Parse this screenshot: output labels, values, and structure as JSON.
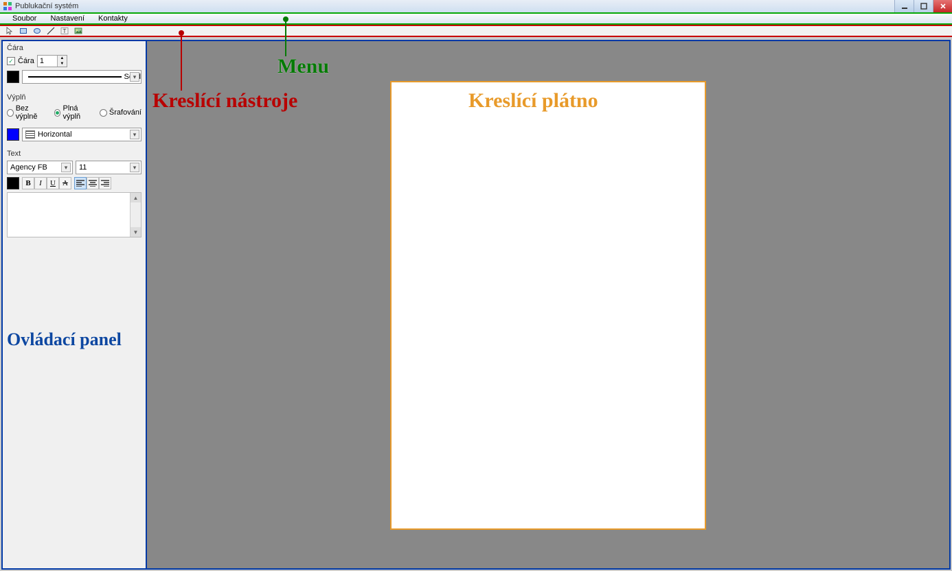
{
  "window": {
    "title": "Publukační systém"
  },
  "menu": {
    "items": [
      "Soubor",
      "Nastavení",
      "Kontakty"
    ]
  },
  "toolbar": {
    "tools": [
      "pointer",
      "rectangle",
      "ellipse",
      "line",
      "text",
      "image"
    ]
  },
  "panel": {
    "line": {
      "group_label": "Čára",
      "checkbox_label": "Čára",
      "checkbox_checked": true,
      "width_value": "1",
      "style_label": "Solid",
      "color": "#000000"
    },
    "fill": {
      "group_label": "Výplň",
      "options": [
        {
          "label": "Bez výplně",
          "selected": false
        },
        {
          "label": "Plná výplň",
          "selected": true
        },
        {
          "label": "Šrafování",
          "selected": false
        }
      ],
      "color": "#0000ff",
      "hatch_label": "Horizontal"
    },
    "text": {
      "group_label": "Text",
      "font_name": "Agency FB",
      "font_size": "11",
      "color": "#000000"
    }
  },
  "annotations": {
    "menu": "Menu",
    "tools": "Kreslící nástroje",
    "panel": "Ovládací panel",
    "canvas": "Kreslící plátno"
  }
}
